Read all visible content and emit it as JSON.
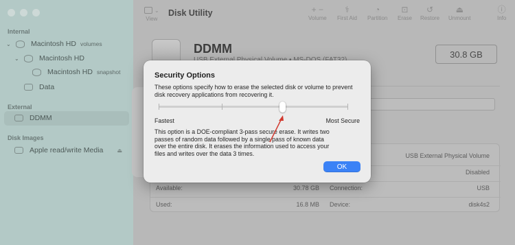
{
  "window": {
    "title": "Disk Utility",
    "toolbar": {
      "view": "View",
      "volume": "Volume",
      "first_aid": "First Aid",
      "partition": "Partition",
      "erase": "Erase",
      "restore": "Restore",
      "unmount": "Unmount",
      "info": "Info"
    }
  },
  "sidebar": {
    "internal_label": "Internal",
    "external_label": "External",
    "disk_images_label": "Disk Images",
    "items": [
      {
        "label": "Macintosh HD",
        "sub": "volumes"
      },
      {
        "label": "Macintosh HD",
        "sub": ""
      },
      {
        "label": "Macintosh HD",
        "sub": "snapshot"
      },
      {
        "label": "Data",
        "sub": ""
      },
      {
        "label": "DDMM",
        "sub": "",
        "selected": true
      },
      {
        "label": "Apple read/write Media",
        "sub": ""
      }
    ]
  },
  "disk": {
    "name": "DDMM",
    "description": "USB External Physical Volume • MS-DOS (FAT32)",
    "capacity": "30.8 GB"
  },
  "info": {
    "available_label": "Available:",
    "available_value": "30.78 GB",
    "used_label": "Used:",
    "used_value": "16.8 MB",
    "connection_label": "Connection:",
    "connection_value": "USB",
    "device_label": "Device:",
    "device_value": "disk4s2",
    "type_value": "USB External Physical Volume",
    "owners_value": "Disabled"
  },
  "dialog": {
    "title": "Security Options",
    "intro": "These options specify how to erase the selected disk or volume to prevent disk recovery applications from recovering it.",
    "fastest_label": "Fastest",
    "most_secure_label": "Most Secure",
    "description": "This option is a DOE-compliant 3-pass secure erase. It writes two passes of random data followed by a single pass of known data over the entire disk. It erases the information used to access your files and writes over the data 3 times.",
    "ok_label": "OK",
    "slider_level": 3,
    "slider_steps": 4
  },
  "colors": {
    "accent": "#3b82f6",
    "annotation_arrow": "#d23a2f"
  }
}
